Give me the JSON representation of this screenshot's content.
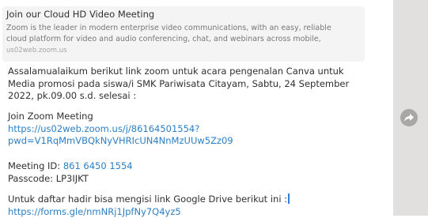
{
  "preview": {
    "title": "Join our Cloud HD Video Meeting",
    "description_lines": [
      "Zoom is the leader in modern enterprise video communications, with an easy, reliable",
      "cloud platform for video and audio conferencing, chat, and webinars across mobile,"
    ],
    "domain": "us02web.zoom.us"
  },
  "message": {
    "greeting_lines": [
      "Assalamualaikum berikut link zoom untuk acara pengenalan Canva untuk",
      "Media promosi pada siswa/i SMK Pariwisata Citayam, Sabtu, 24 September",
      "2022, pk.09.00 s.d. selesai :"
    ],
    "join_label": "Join Zoom Meeting",
    "join_link_lines": [
      "https://us02web.zoom.us/j/86164501554?",
      "pwd=V1RqMmVBQkNyVHRIcUN4NnMzUUw5Zz09"
    ],
    "meeting_id_label": "Meeting ID: ",
    "meeting_id_value": "861 6450 1554",
    "passcode_line": "Passcode: LP3IJKT",
    "attendance_text": "Untuk daftar hadir bisa mengisi link Google Drive berikut ini :",
    "attendance_link": "https://forms.gle/nmNRj1JpfNy7Q4yz5"
  },
  "actions": {
    "share_icon": "forward-arrow-icon"
  },
  "colors": {
    "link": "#2b7fc4",
    "preview_bg": "#f3f4f3",
    "rail_bg": "#e2e0de",
    "share_button_bg": "#a9a7a5"
  }
}
